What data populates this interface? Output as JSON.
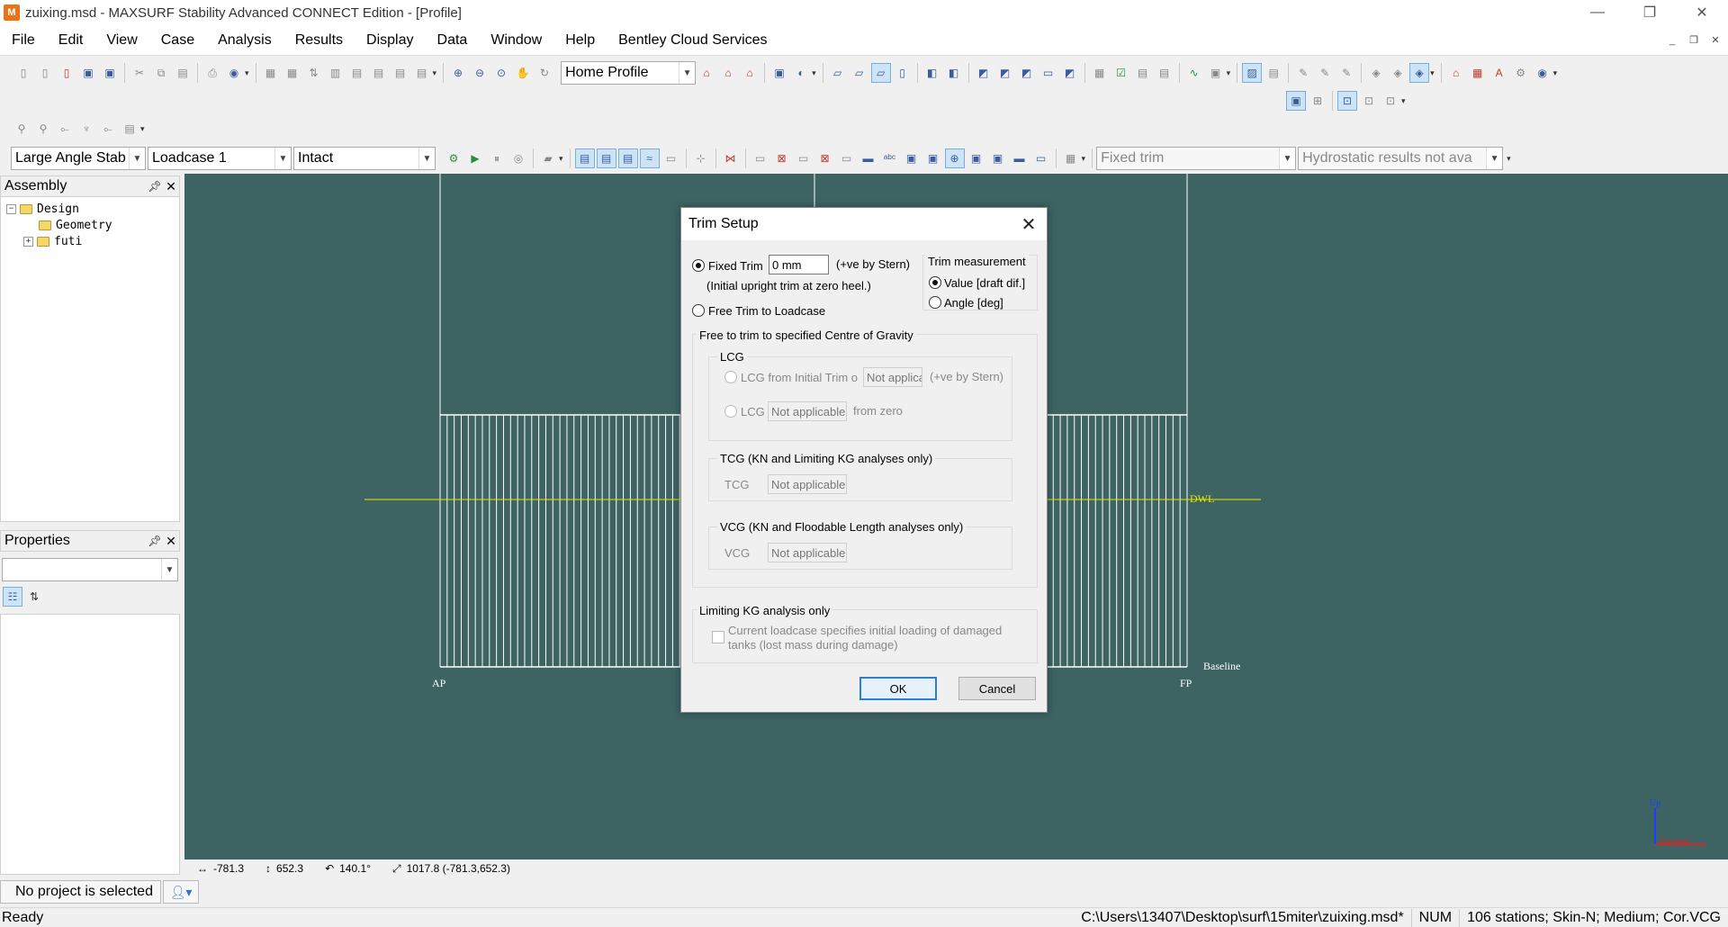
{
  "window": {
    "title": "zuixing.msd - MAXSURF Stability Advanced CONNECT Edition - [Profile]",
    "app_icon": "maxsurf-icon"
  },
  "menu": [
    "File",
    "Edit",
    "View",
    "Case",
    "Analysis",
    "Results",
    "Display",
    "Data",
    "Window",
    "Help",
    "Bentley Cloud Services"
  ],
  "toolbar": {
    "view_combo": "Home Profile",
    "analysis_combo": "Large Angle Stab",
    "loadcase_combo": "Loadcase 1",
    "condition_combo": "Intact",
    "trim_combo": "Fixed trim",
    "hydrostatic_combo": "Hydrostatic results not ava"
  },
  "assembly": {
    "title": "Assembly",
    "tree": [
      {
        "label": "Design",
        "expander": "−",
        "indent": 0
      },
      {
        "label": "Geometry",
        "expander": "",
        "indent": 1
      },
      {
        "label": "futi",
        "expander": "+",
        "indent": 1
      }
    ]
  },
  "properties": {
    "title": "Properties"
  },
  "project": {
    "label": "No project is selected"
  },
  "canvas": {
    "dwl_label": "DWL",
    "baseline_label": "Baseline",
    "ap_label": "AP",
    "fp_label": "FP",
    "axis_up": "Up",
    "axis_fwd": "Forward",
    "colors": {
      "background": "#3d6363",
      "waterline": "#e6e600",
      "hull": "#ffffff"
    }
  },
  "coords": {
    "x": "-781.3",
    "y": "652.3",
    "angle": "140.1°",
    "dist": "1017.8 (-781.3,652.3)"
  },
  "status": {
    "left": "Ready",
    "path": "C:\\Users\\13407\\Desktop\\surf\\15miter\\zuixing.msd*",
    "num": "NUM",
    "info": "106 stations; Skin-N; Medium; Cor.VCG"
  },
  "dialog": {
    "title": "Trim Setup",
    "fixed_trim_label": "Fixed Trim",
    "fixed_trim_value": "0 mm",
    "stern_note": "(+ve by Stern)",
    "initial_note": "(Initial upright trim at zero heel.)",
    "free_trim_label": "Free Trim to Loadcase",
    "measurement_title": "Trim measurement",
    "measure_value": "Value [draft dif.]",
    "measure_angle": "Angle [deg]",
    "free_group_title": "Free to trim to specified Centre of Gravity",
    "lcg_title": "LCG",
    "lcg_initial_label": "LCG from Initial Trim o",
    "lcg_initial_value": "Not applica",
    "lcg_initial_note": "(+ve by Stern)",
    "lcg_label": "LCG",
    "lcg_value": "Not applicable",
    "lcg_note": "from zero",
    "tcg_title": "TCG (KN and Limiting KG analyses only)",
    "tcg_label": "TCG",
    "tcg_value": "Not applicable",
    "vcg_title": "VCG (KN and Floodable Length analyses only)",
    "vcg_label": "VCG",
    "vcg_value": "Not applicable",
    "limiting_title": "Limiting KG analysis only",
    "limiting_check": "Current loadcase specifies initial loading of damaged tanks (lost mass during damage)",
    "ok": "OK",
    "cancel": "Cancel"
  }
}
